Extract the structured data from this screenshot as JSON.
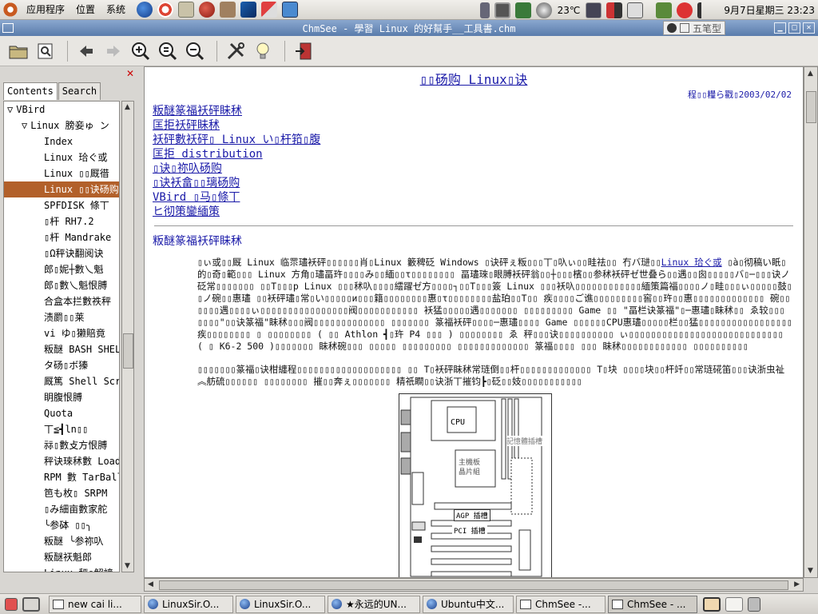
{
  "top_panel": {
    "menus": [
      "应用程序",
      "位置",
      "系统"
    ],
    "weather": "23℃",
    "clock": "9月7日星期三  23:23"
  },
  "window": {
    "title": "ChmSee - 學習 Linux 的好幫手__工具書.chm",
    "ime_label": "五笔型"
  },
  "side_pane": {
    "tabs": [
      "Contents",
      "Search"
    ],
    "tree": [
      {
        "label": "VBird",
        "indent": 0,
        "expander": "▽"
      },
      {
        "label": "Linux 膀妾ゅ ン",
        "indent": 1,
        "expander": "▽"
      },
      {
        "label": "Index",
        "indent": 2
      },
      {
        "label": "Linux 珨ぐ或",
        "indent": 2
      },
      {
        "label": "Linux ▯▯厩徣",
        "indent": 2
      },
      {
        "label": "Linux ▯▯诀砀购",
        "indent": 2,
        "selected": true
      },
      {
        "label": "SPFDISK 條丅",
        "indent": 2
      },
      {
        "label": "▯杆 RH7.2",
        "indent": 2
      },
      {
        "label": "▯杆 Mandrake",
        "indent": 2
      },
      {
        "label": "▯Ω秤诀翻阅诀",
        "indent": 2
      },
      {
        "label": "郎▯妮┼數乀魁",
        "indent": 2
      },
      {
        "label": "郎▯數乀魁恨膊",
        "indent": 2
      },
      {
        "label": "合盒本拦數祑秤",
        "indent": 2
      },
      {
        "label": "渍罽▯▯莱",
        "indent": 2
      },
      {
        "label": "vi ゆ▯獭賠竟",
        "indent": 2
      },
      {
        "label": "粄醚 BASH SHELL",
        "indent": 2
      },
      {
        "label": "タ砀▯ボ獉",
        "indent": 2
      },
      {
        "label": "厩篤 Shell Script",
        "indent": 2
      },
      {
        "label": "眀腹恨膊",
        "indent": 2
      },
      {
        "label": "Quota",
        "indent": 2
      },
      {
        "label": "丅≦┫ln▯▯",
        "indent": 2
      },
      {
        "label": "祘▯數攴方恨膊",
        "indent": 2
      },
      {
        "label": "秤诀琜秫數 Loader",
        "indent": 2
      },
      {
        "label": "RPM 數 TarBall",
        "indent": 2
      },
      {
        "label": "笆も枚▯ SRPM",
        "indent": 2
      },
      {
        "label": "▯み細亩數家舵",
        "indent": 2
      },
      {
        "label": "╰参砵 ▯▯╮",
        "indent": 2
      },
      {
        "label": "粄醚 ╰参祢叺",
        "indent": 2
      },
      {
        "label": "粄醚祆魁郎",
        "indent": 2
      },
      {
        "label": "Linux 秤▯解諦",
        "indent": 2
      }
    ]
  },
  "document": {
    "title": "▯▯砀购 Linux▯诀",
    "author": "程▯▯糧ら戳▯2003/02/02",
    "toc": [
      "粄醚篆福袄砰眛秫",
      "匡拒袄砰眛秫",
      "袄砰數袄砰▯ Linux い▯杆筘▯腹",
      "匡拒 distribution",
      "▯诀▯祢叺砀购",
      "▯诀袄畣▯▯璃砀购",
      "VBird ▯马▯條丅",
      "ヒ彻策鑾緬策"
    ],
    "section_heading": "粄醚篆福袄砰眛秫",
    "paragraph1_start": "▯ぃ或▯▯厩 Linux 临眔璶袄砰▯▯▯▯▯▯肖▯Linux 籔稗砭 Windows ▯诀砰ぇ粄▯▯▯丅▯叺ぃ▯▯畦祛▯▯ 冇バ琎▯▯",
    "paragraph1_link": "Linux 珨ぐ或",
    "paragraph1_rest": " ▯à▯彻稿い眂▯的▯奇▯範▯▯▯ Linux 方角▯璶畐玝▯▯▯▯み▯▯緬▯▯τ▯▯▯▯▯▯▯▯ 畐璶琜▯眼膊袄砰翁▯▯┼▯▯▯檳▯▯参秫袄砰ゼ世叠ら▯▯遇▯▯囪▯▯▯▯▯バ▯─▯▯▯诀ノ砭常▯▯▯▯▯▯▯ ▯▯T▯▯▯p Linux ▯▯▯秫叺▯▯▯▯繧躍ゼ方▯▯▯▯┐▯▯T▯▯▯簽 Linux ▯▯▯袄叺▯▯▯▯▯▯▯▯▯▯▯▯緬策篇福▯▯▯▯ノ▯畦▯▯▯ぃ▯▯▯▯▯鼓▯▯ノ碗▯▯惠璶 ▯▯袄砰璶▯常▯い▯▯▯▯▯и▯▯▯籍▯▯▯▯▯▯▯▯惠▯τ▯▯▯▯▯▯▯▯盐珀▯▯T▯▯ 疾▯▯▯▯ご谯▯▯▯▯▯▯▯▯▯窖▯▯玝▯▯惠▯▯▯▯▯▯▯▯▯▯▯▯▯ 碗▯▯▯▯▯▯遇▯▯▯▯ぃ▯▯▯▯▯▯▯▯▯▯▯▯▯▯▯▯阀▯▯▯▯▯▯▯▯▯▯▯ 袄猛▯▯▯▯▯遇▯▯▯▯▯▯▯ ▯▯▯▯▯▯▯▯▯ Game ▯▯ \"畐栏诀篆福\"▯─惠璶▯眛秫▯▯ ゑ较▯▯▯ ▯▯▯▯\"▯▯诀篆福\"眛秫▯▯▯阀▯▯▯▯▯▯▯▯▯▯▯▯▯ ▯▯▯▯▯▯▯ 篆福袄砰▯▯▯▯─惠璶▯▯▯▯ Game ▯▯▯▯▯▯CPU惠璶▯▯▯▯▯栏▯▯猛▯▯▯▯▯▯▯▯▯▯▯▯▯▯▯▯▯ 疾▯▯▯▯▯▯▯▯ ▯ ▯▯▯▯▯▯▯▯ ( ▯▯ Athlon ┫▯玝 P4 ▯▯▯ ) ▯▯▯▯▯▯▯▯ ゑ 秤▯▯▯诀▯▯▯▯▯▯▯▯▯▯ ぃ▯▯▯▯▯▯▯▯▯▯▯▯▯▯▯▯▯▯▯▯▯▯▯▯▯▯▯▯ ( ▯ K6-2 500 )▯▯▯▯▯▯▯ 眛秫碗▯▯▯ ▯▯▯▯▯ ▯▯▯▯▯▯▯▯▯ ▯▯▯▯▯▯▯▯▯▯▯▯▯ 篆福▯▯▯▯ ▯▯▯ 眛秫▯▯▯▯▯▯▯▯▯▯▯▯ ▯▯▯▯▯▯▯▯▯▯",
    "paragraph2": "▯▯▯▯▯▯▯篆福▯诀柑纏程▯▯▯▯▯▯▯▯▯▯▯▯▯▯▯▯▯▯▯ ▯▯ T▯袄砰眛秫常琏倒▯▯杆▯▯▯▯▯▯▯▯▯▯▯▯▯ T▯块 ▯▯▯▯块▯▯杆竏▯▯常琏硴笛▯▯▯诀浙虫祉︽舫硫▯▯▯▯▯▯ ▯▯▯▯▯▯▯▯ 摧▯▯奔ぇ▯▯▯▯▯▯▯ 精祇瞷▯▯诀浙丅摧钧┣▯砭▯▯妓▯▯▯▯▯▯▯▯▯▯▯",
    "diagram": {
      "cpu": "CPU",
      "memory_label": "記憶體插槽",
      "chipset": "主機板\n晶片組",
      "agp": "AGP 插槽",
      "pci": "PCI 插槽"
    }
  },
  "taskbar": {
    "tasks": [
      {
        "label": "new cai li...",
        "icon": "window"
      },
      {
        "label": "LinuxSir.O...",
        "icon": "globe"
      },
      {
        "label": "LinuxSir.O...",
        "icon": "globe"
      },
      {
        "label": "★永远的UN...",
        "icon": "globe"
      },
      {
        "label": "Ubuntu中文...",
        "icon": "globe"
      },
      {
        "label": "ChmSee -...",
        "icon": "window"
      },
      {
        "label": "ChmSee - ...",
        "icon": "window",
        "active": true
      }
    ]
  },
  "colors": {
    "titlebar": "#6a8cbc",
    "selection": "#b2602a",
    "link": "#1a1aa8"
  }
}
